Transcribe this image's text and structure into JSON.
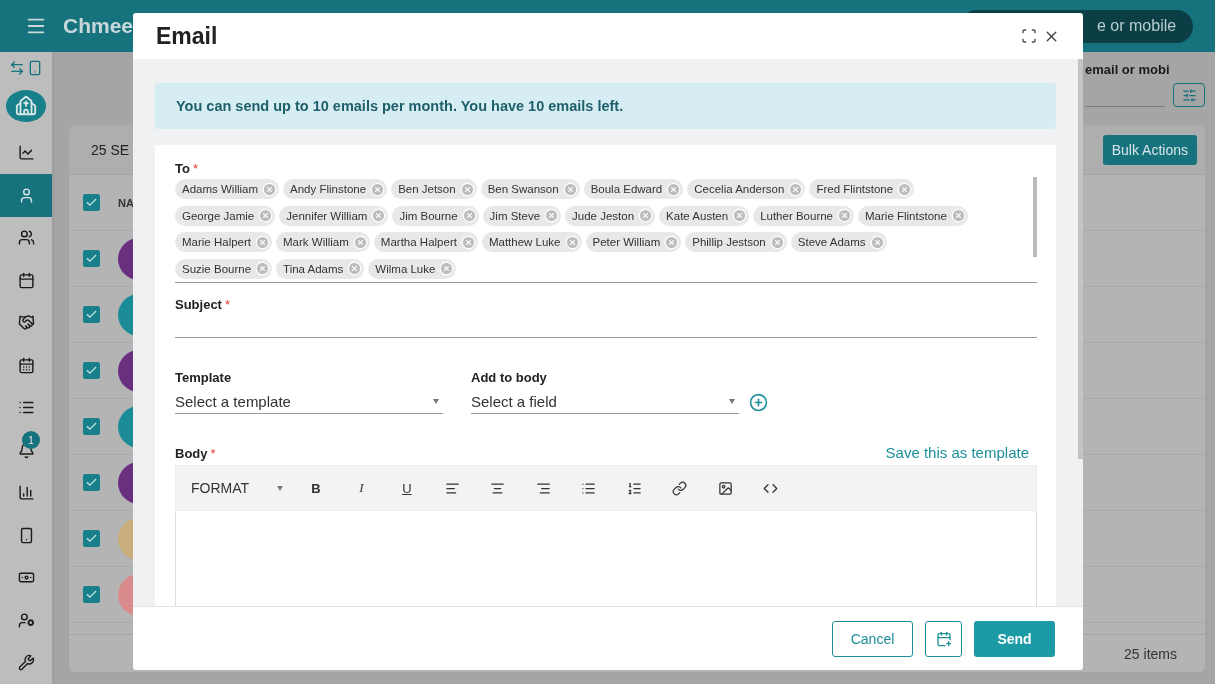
{
  "app": {
    "logo_text": "Chmee",
    "search": {
      "placeholder": "e or mobile"
    },
    "filter_label": "email or mobi"
  },
  "sidebar": {
    "items": [
      {
        "selected": false
      },
      {
        "selected": true
      },
      {
        "selected": false
      },
      {
        "selected": false
      },
      {
        "selected": false
      },
      {
        "selected": false
      },
      {
        "selected": false
      },
      {
        "selected": false,
        "badge": "1"
      },
      {
        "selected": false
      },
      {
        "selected": false
      },
      {
        "selected": false
      },
      {
        "selected": false
      },
      {
        "selected": false
      }
    ]
  },
  "list_card": {
    "selection_count": "25 SE",
    "bulk_button": "Bulk Actions",
    "footer": "25 items",
    "header_checked": true,
    "column_1": "NA",
    "rows": [
      {
        "checked": true,
        "color": "#6a2f7f"
      },
      {
        "checked": true,
        "color": "#1b8c97"
      },
      {
        "checked": true,
        "color": "#6a2f7f"
      },
      {
        "checked": true,
        "color": "#1b8c97"
      },
      {
        "checked": true,
        "color": "#6a2f7f"
      },
      {
        "checked": true,
        "color": "#c9ad7a"
      },
      {
        "checked": true,
        "color": "#d98a8a"
      }
    ]
  },
  "dialog": {
    "title": "Email",
    "notice": "You can send up to 10 emails per month. You have 10 emails left.",
    "to": {
      "label": "To",
      "required_mark": "*",
      "recipients": [
        "Adams William",
        "Andy Flinstone",
        "Ben Jetson",
        "Ben Swanson",
        "Boula Edward",
        "Cecelia Anderson",
        "Fred Flintstone",
        "George Jamie",
        "Jennifer William",
        "Jim Bourne",
        "Jim Steve",
        "Jude Jeston",
        "Kate Austen",
        "Luther Bourne",
        "Marie Flintstone",
        "Marie Halpert",
        "Mark William",
        "Martha Halpert",
        "Matthew Luke",
        "Peter William",
        "Phillip Jestson",
        "Steve Adams",
        "Suzie Bourne",
        "Tina Adams",
        "Wilma Luke"
      ]
    },
    "subject": {
      "label": "Subject",
      "required_mark": "*"
    },
    "template": {
      "label": "Template",
      "placeholder": "Select a template"
    },
    "add_to_body": {
      "label": "Add to body",
      "placeholder": "Select a field"
    },
    "body": {
      "label": "Body",
      "required_mark": "*",
      "save_link": "Save this as template",
      "format_label": "FORMAT",
      "bold": "B",
      "italic": "I",
      "underline": "U"
    },
    "buttons": {
      "cancel": "Cancel",
      "send": "Send"
    }
  }
}
